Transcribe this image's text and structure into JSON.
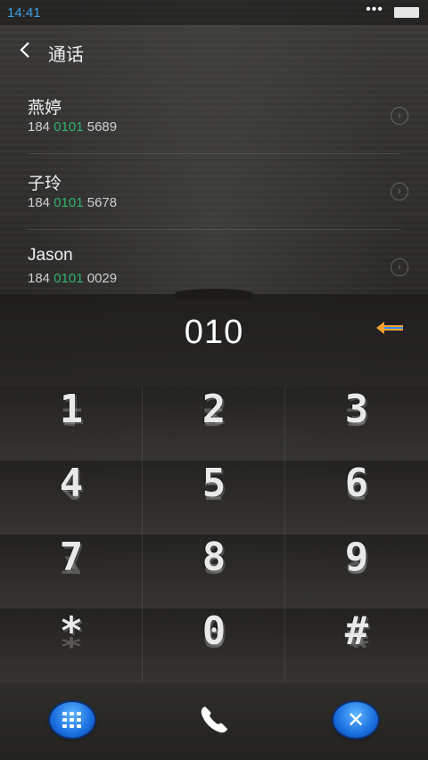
{
  "status_bar": {
    "time": "14:41",
    "dots": "•••"
  },
  "header": {
    "title": "通话"
  },
  "contacts": [
    {
      "name": "燕婷",
      "number_prefix": "184 ",
      "number_match": "0101",
      "number_suffix": " 5689"
    },
    {
      "name": "子玲",
      "number_prefix": "184 ",
      "number_match": "0101",
      "number_suffix": " 5678"
    },
    {
      "name": "Jason",
      "number_prefix": "184 ",
      "number_match": "0101",
      "number_suffix": " 0029"
    }
  ],
  "dial_input": {
    "value": "010"
  },
  "keypad": {
    "keys": [
      "1",
      "2",
      "3",
      "4",
      "5",
      "6",
      "7",
      "8",
      "9",
      "*",
      "0",
      "#"
    ]
  },
  "colors": {
    "accent_blue": "#3aa0e8",
    "match_green": "#2fb36a",
    "backspace_orange": "#f0a030"
  }
}
